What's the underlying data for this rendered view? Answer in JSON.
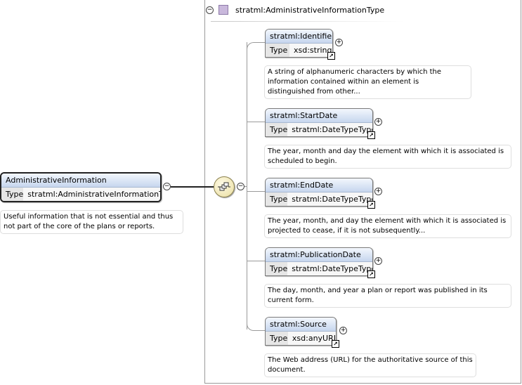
{
  "main_element": {
    "name": "AdministrativeInformation",
    "type_label": "Type",
    "type_value": "stratml:AdministrativeInformationType",
    "annotation": "Useful information that is not essential and thus not part of the core of the plans or reports."
  },
  "complex_type": {
    "name": "stratml:AdministrativeInformationType",
    "collapse_symbol": "−"
  },
  "sequence": {
    "collapse_symbol": "−"
  },
  "children": [
    {
      "name": "stratml:Identifier",
      "type_label": "Type",
      "type_value": "xsd:string",
      "annotation": "A string of alphanumeric characters by which the information contained within an element is distinguished from other...",
      "expand_symbol": "+",
      "link_symbol": "↗"
    },
    {
      "name": "stratml:StartDate",
      "type_label": "Type",
      "type_value": "stratml:DateTypeType",
      "annotation": "The year, month and day the element with which it is associated is scheduled to begin.",
      "expand_symbol": "+",
      "link_symbol": "↗"
    },
    {
      "name": "stratml:EndDate",
      "type_label": "Type",
      "type_value": "stratml:DateTypeType",
      "annotation": "The year, month, and day the element with which it is associated is projected to cease, if it is not subsequently...",
      "expand_symbol": "+",
      "link_symbol": "↗"
    },
    {
      "name": "stratml:PublicationDate",
      "type_label": "Type",
      "type_value": "stratml:DateTypeType",
      "annotation": "The day, month, and year a plan or report was published in its current form.",
      "expand_symbol": "+",
      "link_symbol": "↗"
    },
    {
      "name": "stratml:Source",
      "type_label": "Type",
      "type_value": "xsd:anyURI",
      "annotation": "The Web address (URL) for the authoritative source of this document.",
      "expand_symbol": "+",
      "link_symbol": "↗"
    }
  ],
  "main_toggle_symbol": "−"
}
